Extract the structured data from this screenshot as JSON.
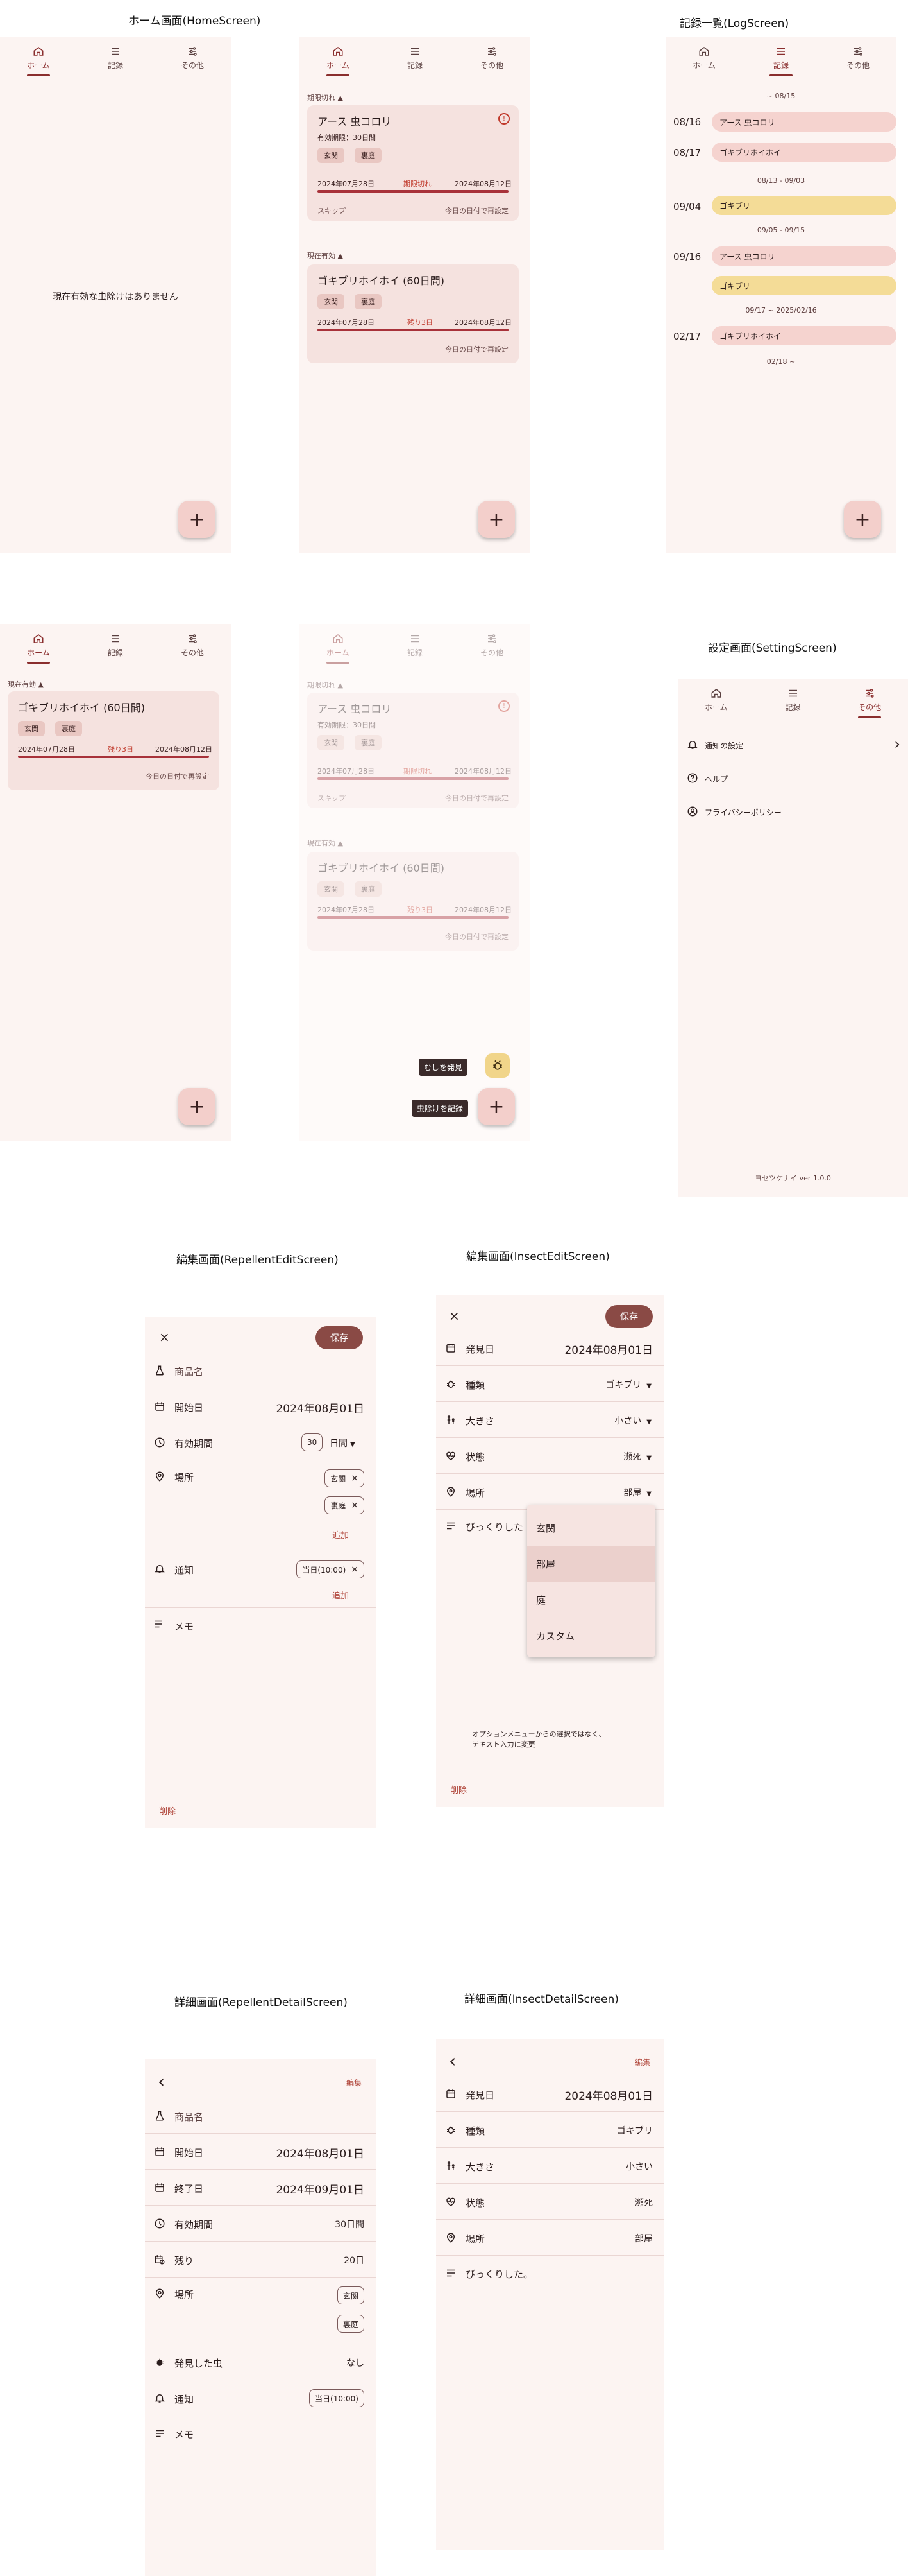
{
  "headings": {
    "home": "ホーム画面(HomeScreen)",
    "log": "記録一覧(LogScreen)",
    "setting": "設定画面(SettingScreen)",
    "repellent_edit": "編集画面(RepellentEditScreen)",
    "insect_edit": "編集画面(InsectEditScreen)",
    "repellent_detail": "詳細画面(RepellentDetailScreen)",
    "insect_detail": "詳細画面(InsectDetailScreen)"
  },
  "nav": {
    "home": "ホーム",
    "log": "記録",
    "other": "その他"
  },
  "fab_plus": "+",
  "empty_message": "現在有効な虫除けはありません",
  "home": {
    "expired_header": "期限切れ ▲",
    "active_header": "現在有効 ▲",
    "expired_card": {
      "title": "アース 虫コロリ",
      "subtitle": "有効期限：30日間",
      "chips": [
        "玄関",
        "裏庭"
      ],
      "start": "2024年07月28日",
      "status": "期限切れ",
      "end": "2024年08月12日",
      "skip": "スキップ",
      "reset": "今日の日付で再設定"
    },
    "active_card": {
      "title": "ゴキブリホイホイ (60日間)",
      "chips": [
        "玄関",
        "裏庭"
      ],
      "start": "2024年07月28日",
      "status": "残り3日",
      "end": "2024年08月12日",
      "reset": "今日の日付で再設定"
    },
    "fab_found": "むしを発見",
    "fab_record": "虫除けを記録"
  },
  "log": {
    "ranges": [
      "~ 08/15",
      "08/13 - 09/03",
      "09/05 - 09/15",
      "09/17 ~ 2025/02/16",
      "02/18 ~"
    ],
    "rows": [
      {
        "date": "08/16",
        "label": "アース 虫コロリ",
        "color": "pink"
      },
      {
        "date": "08/17",
        "label": "ゴキブリホイホイ",
        "color": "pink"
      },
      {
        "date": "09/04",
        "label": "ゴキブリ",
        "color": "yellow"
      },
      {
        "date": "09/16",
        "label": "アース 虫コロリ",
        "color": "pink"
      },
      {
        "date": "",
        "label": "ゴキブリ",
        "color": "yellow"
      },
      {
        "date": "02/17",
        "label": "ゴキブリホイホイ",
        "color": "pink"
      }
    ]
  },
  "setting": {
    "notify": "通知の設定",
    "help": "ヘルプ",
    "privacy": "プライバシーポリシー",
    "version": "ヨセツケナイ ver 1.0.0"
  },
  "repellent_edit": {
    "close": "×",
    "save": "保存",
    "product_name_placeholder": "商品名",
    "start_label": "開始日",
    "start_value": "2024年08月01日",
    "period_label": "有効期間",
    "period_number": "30",
    "period_unit": "日間",
    "place_label": "場所",
    "places": [
      "玄関",
      "裏庭"
    ],
    "add": "追加",
    "notify_label": "通知",
    "notify_value": "当日(10:00)",
    "memo_label": "メモ",
    "delete": "削除"
  },
  "insect_edit": {
    "close": "×",
    "save": "保存",
    "found_label": "発見日",
    "found_value": "2024年08月01日",
    "kind_label": "種類",
    "kind_value": "ゴキブリ",
    "size_label": "大きさ",
    "size_value": "小さい",
    "state_label": "状態",
    "state_value": "瀕死",
    "place_label": "場所",
    "place_value": "部屋",
    "memo_value": "びっくりした",
    "menu_options": [
      "玄関",
      "部屋",
      "庭",
      "カスタム"
    ],
    "note": "オプションメニューからの選択ではなく、\nテキスト入力に変更",
    "delete": "削除"
  },
  "repellent_detail": {
    "edit": "編集",
    "product_name": "商品名",
    "start_label": "開始日",
    "start_value": "2024年08月01日",
    "end_label": "終了日",
    "end_value": "2024年09月01日",
    "period_label": "有効期間",
    "period_value": "30日間",
    "remain_label": "残り",
    "remain_value": "20日",
    "place_label": "場所",
    "places": [
      "玄関",
      "裏庭"
    ],
    "found_label": "発見した虫",
    "found_value": "なし",
    "notify_label": "通知",
    "notify_value": "当日(10:00)",
    "memo_label": "メモ"
  },
  "insect_detail": {
    "edit": "編集",
    "found_label": "発見日",
    "found_value": "2024年08月01日",
    "kind_label": "種類",
    "kind_value": "ゴキブリ",
    "size_label": "大きさ",
    "size_value": "小さい",
    "state_label": "状態",
    "state_value": "瀕死",
    "place_label": "場所",
    "place_value": "部屋",
    "memo_value": "びっくりした。"
  },
  "colors": {
    "accent": "#8a2e2e",
    "background": "#fcf4f2",
    "card": "#f5e2df",
    "chip": "#e9c7c2",
    "progress": "#a8323a",
    "log_pink": "#f5d3cf",
    "log_yellow": "#f4dc97",
    "save": "#8a4a45"
  },
  "icons": {
    "home": "home-icon",
    "log": "list-icon",
    "other": "sliders-icon",
    "bell": "bell-icon",
    "help": "help-circle-icon",
    "privacy": "user-circle-icon",
    "calendar": "calendar-icon",
    "clock": "clock-icon",
    "pin": "map-pin-icon",
    "bug": "bug-icon",
    "flask": "flask-icon"
  }
}
